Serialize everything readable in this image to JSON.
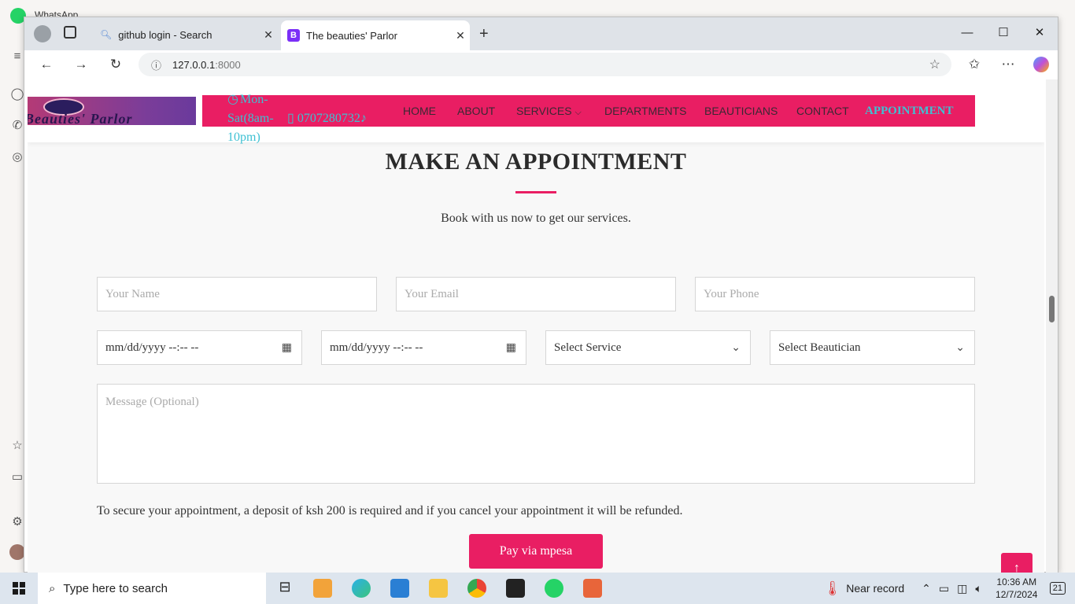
{
  "background_app": {
    "title": "WhatsApp"
  },
  "browser": {
    "tabs": [
      {
        "label": "github login - Search",
        "icon": "search-icon"
      },
      {
        "label": "The beauties' Parlor",
        "icon": "bootstrap-icon"
      }
    ],
    "address": {
      "host": "127.0.0.1",
      "port": ":8000"
    }
  },
  "site": {
    "logo_text": "Beauties' Parlor",
    "hours": "Mon-Sat(8am-10pm)",
    "phone": "0707280732",
    "nav": [
      {
        "label": "HOME"
      },
      {
        "label": "ABOUT"
      },
      {
        "label": "SERVICES"
      },
      {
        "label": "DEPARTMENTS"
      },
      {
        "label": "BEAUTICIANS"
      },
      {
        "label": "CONTACT"
      },
      {
        "label": "APPOINTMENT"
      }
    ]
  },
  "section": {
    "title": "MAKE AN APPOINTMENT",
    "subtitle": "Book with us now to get our services."
  },
  "form": {
    "name_placeholder": "Your Name",
    "email_placeholder": "Your Email",
    "phone_placeholder": "Your Phone",
    "date1_value": "mm/dd/yyyy --:-- --",
    "date2_value": "mm/dd/yyyy --:-- --",
    "service_value": "Select Service",
    "beautician_value": "Select Beautician",
    "message_placeholder": "Message (Optional)",
    "notice": "To secure your appointment, a deposit of ksh 200 is required and if you cancel your appointment it will be refunded.",
    "pay_label": "Pay via mpesa"
  },
  "taskbar": {
    "search_placeholder": "Type here to search",
    "weather": "Near record",
    "time": "10:36 AM",
    "date": "12/7/2024",
    "notifications": "21"
  },
  "colors": {
    "accent": "#e91e63",
    "teal": "#3ec1d3"
  }
}
